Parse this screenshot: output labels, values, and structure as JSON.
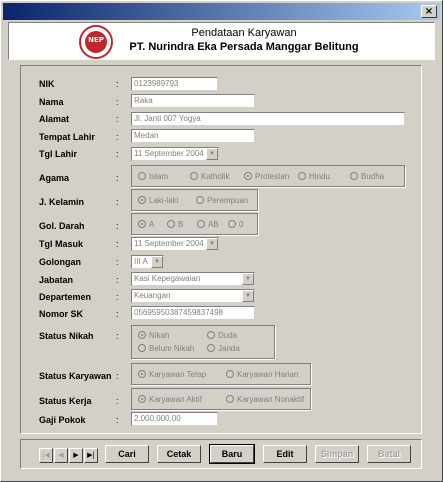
{
  "window": {
    "close_icon": "×"
  },
  "header": {
    "title": "Pendataan Karyawan",
    "company": "PT. Nurindra Eka Persada Manggar Belitung",
    "logo_text": "NEP"
  },
  "colon": ":",
  "fields": {
    "nik": {
      "label": "NIK",
      "value": "0123989793"
    },
    "nama": {
      "label": "Nama",
      "value": "Raka"
    },
    "alamat": {
      "label": "Alamat",
      "value": "Jl. Janti 007 Yogya"
    },
    "tempat_lahir": {
      "label": "Tempat Lahir",
      "value": "Medan"
    },
    "tgl_lahir": {
      "label": "Tgl Lahir",
      "value": "11 September 2004"
    },
    "agama": {
      "label": "Agama",
      "options": [
        "Islam",
        "Katholik",
        "Protestan",
        "Hindu",
        "Budha"
      ],
      "selected": "Protestan"
    },
    "jenis_kelamin": {
      "label": "J. Kelamin",
      "options": [
        "Laki-laki",
        "Perempuan"
      ],
      "selected": "Laki-laki"
    },
    "gol_darah": {
      "label": "Gol. Darah",
      "options": [
        "A",
        "B",
        "AB",
        "0"
      ],
      "selected": "A"
    },
    "tgl_masuk": {
      "label": "Tgl Masuk",
      "value": "11 September 2004"
    },
    "golongan": {
      "label": "Golongan",
      "value": "III A"
    },
    "jabatan": {
      "label": "Jabatan",
      "value": "Kasi Kepegawaian"
    },
    "departemen": {
      "label": "Departemen",
      "value": "Keuangan"
    },
    "nomor_sk": {
      "label": "Nomor SK",
      "value": "05695950387459837498"
    },
    "status_nikah": {
      "label": "Status Nikah",
      "options": [
        "Nikah",
        "Duda",
        "Belum Nikah",
        "Janda"
      ],
      "selected": "Nikah"
    },
    "status_karyawan": {
      "label": "Status Karyawan",
      "options": [
        "Karyawan Tetap",
        "Karyawan Harian"
      ],
      "selected": "Karyawan Tetap"
    },
    "status_kerja": {
      "label": "Status Kerja",
      "options": [
        "Karyawan Aktif",
        "Karyawan Nonaktif"
      ],
      "selected": "Karyawan Aktif"
    },
    "gaji_pokok": {
      "label": "Gaji Pokok",
      "value": "2.000.000,00"
    }
  },
  "navigator": {
    "first": "|◀",
    "prev": "◀",
    "next": "▶",
    "last": "▶|"
  },
  "buttons": {
    "cari": "Cari",
    "cetak": "Cetak",
    "baru": "Baru",
    "edit": "Edit",
    "simpan": "Simpan",
    "batal": "Batal"
  },
  "colors": {
    "title_start": "#0a246a",
    "title_end": "#a6caf0",
    "logo_red": "#c0282d",
    "face": "#d4d0c8"
  }
}
